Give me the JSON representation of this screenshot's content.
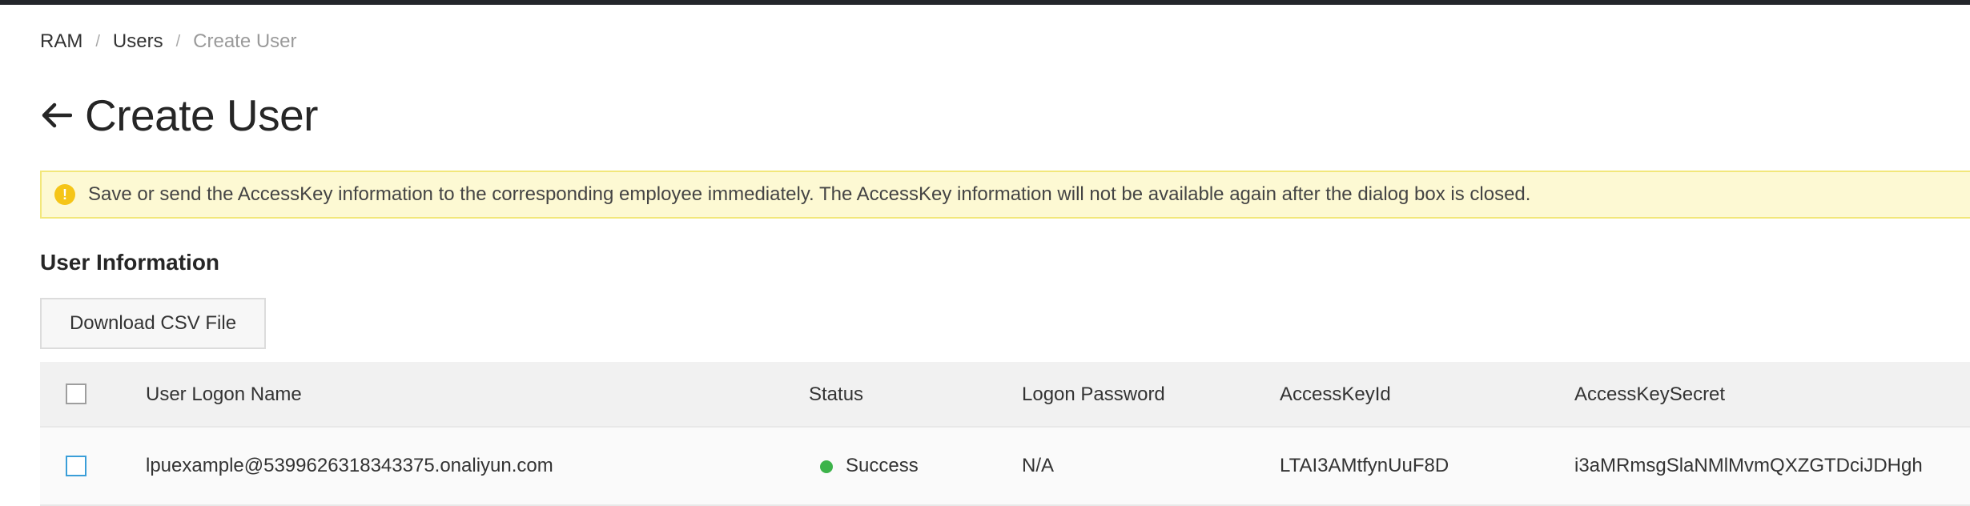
{
  "breadcrumb": {
    "items": [
      "RAM",
      "Users"
    ],
    "current": "Create User"
  },
  "header": {
    "title": "Create User",
    "back_icon": "arrow-left-icon"
  },
  "alert": {
    "icon": "warning-icon",
    "text": "Save or send the AccessKey information to the corresponding employee immediately. The AccessKey information will not be available again after the dialog box is closed."
  },
  "section": {
    "title": "User Information",
    "download_button": "Download CSV File"
  },
  "table": {
    "columns": [
      "User Logon Name",
      "Status",
      "Logon Password",
      "AccessKeyId",
      "AccessKeySecret"
    ],
    "rows": [
      {
        "logon_name": "lpuexample@5399626318343375.onaliyun.com",
        "status": "Success",
        "password": "N/A",
        "access_key_id": "LTAI3AMtfynUuF8D",
        "access_key_secret": "i3aMRmsgSlaNMlMvmQXZGTDciJDHgh"
      }
    ]
  },
  "colors": {
    "topbar": "#23262b",
    "alert_bg": "#fdf9d3",
    "alert_border": "#f2e77a",
    "warning": "#f5c518",
    "success": "#3cb34a",
    "checkbox_active": "#3a9ed8"
  }
}
